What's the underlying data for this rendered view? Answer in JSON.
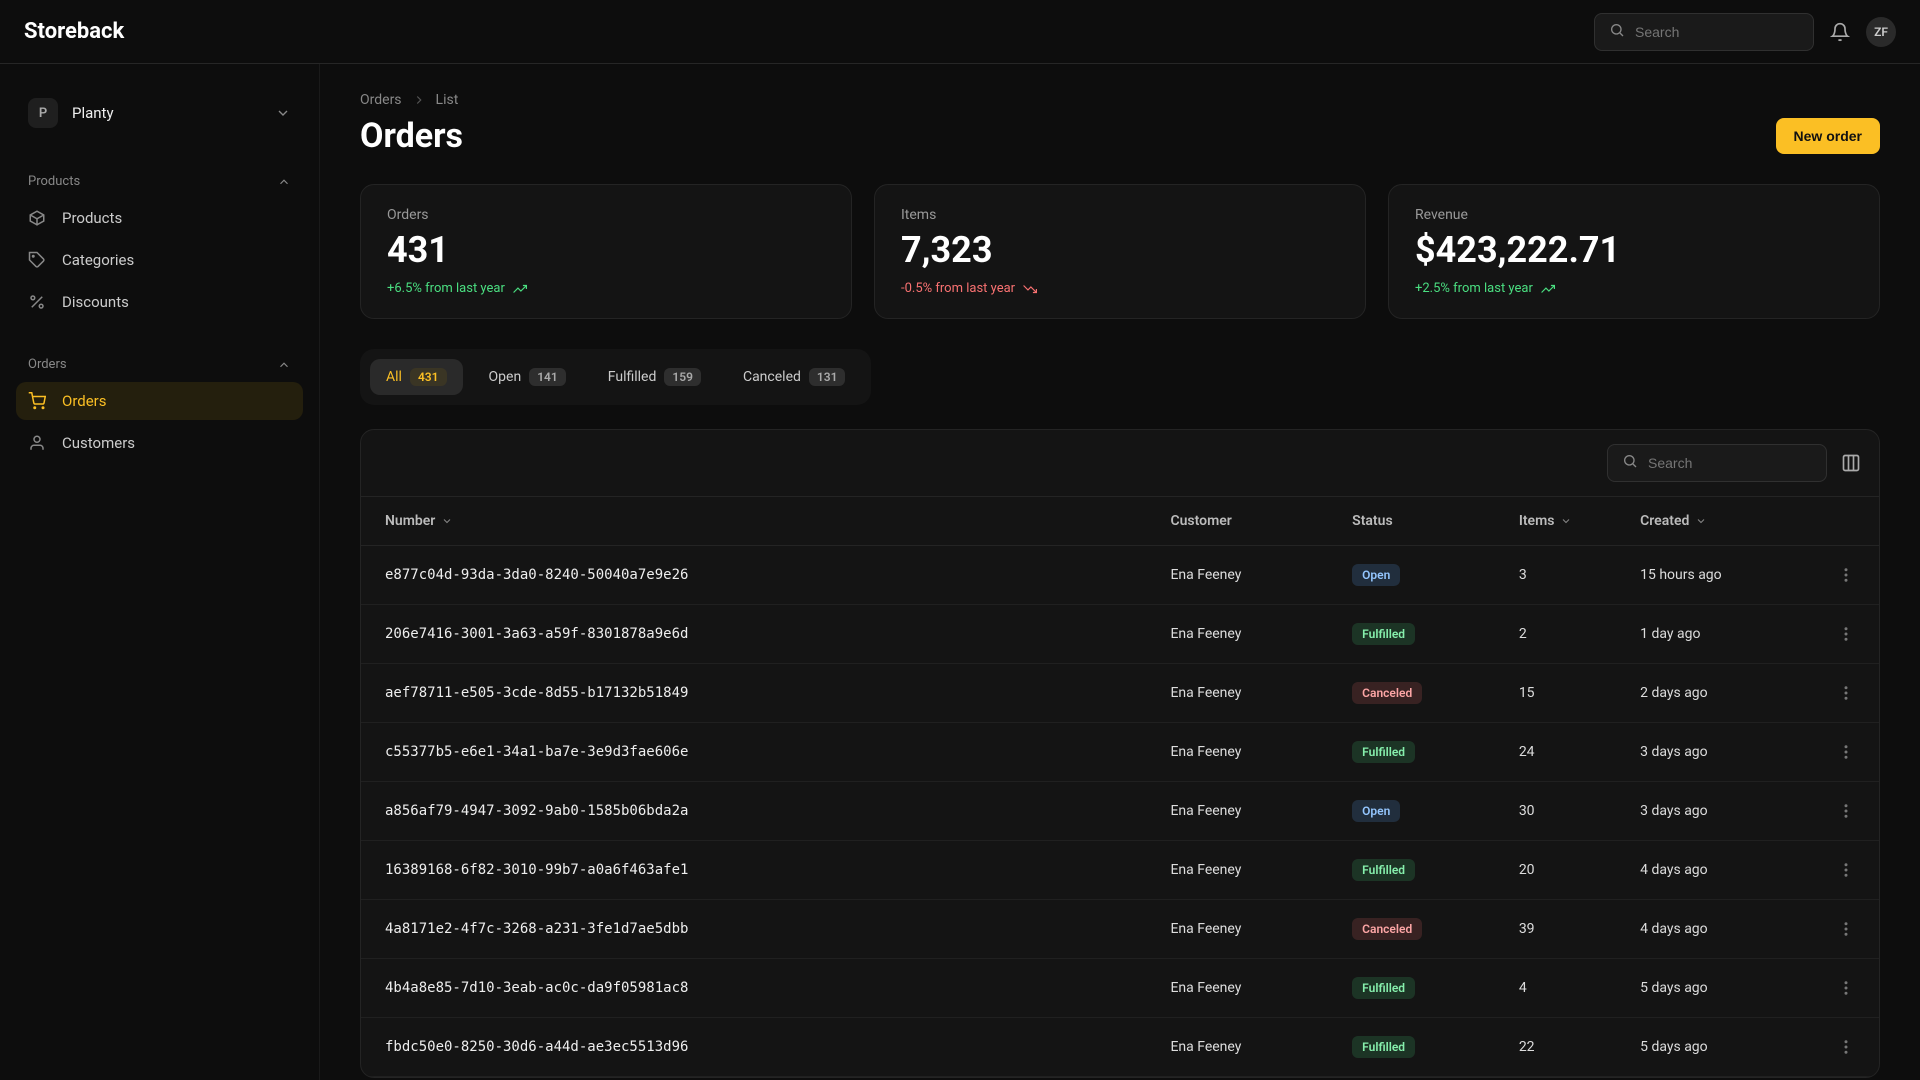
{
  "brand": "Storeback",
  "search_placeholder": "Search",
  "user_initials": "ZF",
  "store": {
    "initial": "P",
    "name": "Planty"
  },
  "sidebar": {
    "products": {
      "header": "Products",
      "items": [
        {
          "label": "Products"
        },
        {
          "label": "Categories"
        },
        {
          "label": "Discounts"
        }
      ]
    },
    "orders": {
      "header": "Orders",
      "items": [
        {
          "label": "Orders"
        },
        {
          "label": "Customers"
        }
      ]
    }
  },
  "breadcrumb": {
    "parent": "Orders",
    "current": "List"
  },
  "page_title": "Orders",
  "new_order_label": "New order",
  "stats": [
    {
      "label": "Orders",
      "value": "431",
      "delta": "+6.5% from last year",
      "dir": "up"
    },
    {
      "label": "Items",
      "value": "7,323",
      "delta": "-0.5% from last year",
      "dir": "down"
    },
    {
      "label": "Revenue",
      "value": "$423,222.71",
      "delta": "+2.5% from last year",
      "dir": "up"
    }
  ],
  "tabs": [
    {
      "label": "All",
      "count": "431",
      "active": true
    },
    {
      "label": "Open",
      "count": "141",
      "active": false
    },
    {
      "label": "Fulfilled",
      "count": "159",
      "active": false
    },
    {
      "label": "Canceled",
      "count": "131",
      "active": false
    }
  ],
  "table": {
    "search_placeholder": "Search",
    "columns": {
      "number": "Number",
      "customer": "Customer",
      "status": "Status",
      "items": "Items",
      "created": "Created"
    },
    "rows": [
      {
        "number": "e877c04d-93da-3da0-8240-50040a7e9e26",
        "customer": "Ena Feeney",
        "status": "Open",
        "items": "3",
        "created": "15 hours ago"
      },
      {
        "number": "206e7416-3001-3a63-a59f-8301878a9e6d",
        "customer": "Ena Feeney",
        "status": "Fulfilled",
        "items": "2",
        "created": "1 day ago"
      },
      {
        "number": "aef78711-e505-3cde-8d55-b17132b51849",
        "customer": "Ena Feeney",
        "status": "Canceled",
        "items": "15",
        "created": "2 days ago"
      },
      {
        "number": "c55377b5-e6e1-34a1-ba7e-3e9d3fae606e",
        "customer": "Ena Feeney",
        "status": "Fulfilled",
        "items": "24",
        "created": "3 days ago"
      },
      {
        "number": "a856af79-4947-3092-9ab0-1585b06bda2a",
        "customer": "Ena Feeney",
        "status": "Open",
        "items": "30",
        "created": "3 days ago"
      },
      {
        "number": "16389168-6f82-3010-99b7-a0a6f463afe1",
        "customer": "Ena Feeney",
        "status": "Fulfilled",
        "items": "20",
        "created": "4 days ago"
      },
      {
        "number": "4a8171e2-4f7c-3268-a231-3fe1d7ae5dbb",
        "customer": "Ena Feeney",
        "status": "Canceled",
        "items": "39",
        "created": "4 days ago"
      },
      {
        "number": "4b4a8e85-7d10-3eab-ac0c-da9f05981ac8",
        "customer": "Ena Feeney",
        "status": "Fulfilled",
        "items": "4",
        "created": "5 days ago"
      },
      {
        "number": "fbdc50e0-8250-30d6-a44d-ae3ec5513d96",
        "customer": "Ena Feeney",
        "status": "Fulfilled",
        "items": "22",
        "created": "5 days ago"
      }
    ]
  }
}
